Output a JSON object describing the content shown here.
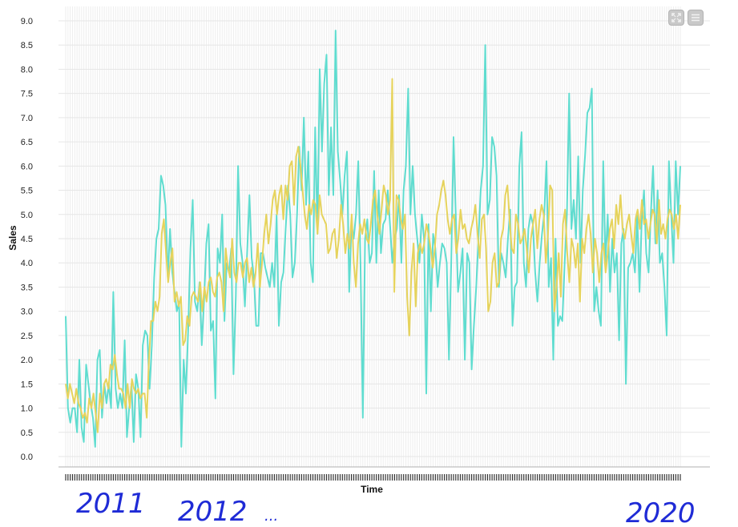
{
  "toolbar": {
    "expand_icon": "expand-icon",
    "menu_icon": "menu-icon"
  },
  "annotations": [
    "2011",
    "2012",
    "...",
    "2020"
  ],
  "chart_data": {
    "type": "line",
    "xlabel": "Time",
    "ylabel": "Sales",
    "ylim": [
      0,
      9
    ],
    "yticks": [
      "0.0",
      "0.5",
      "1.0",
      "1.5",
      "2.0",
      "2.5",
      "3.0",
      "3.5",
      "4.0",
      "4.5",
      "5.0",
      "5.5",
      "6.0",
      "6.5",
      "7.0",
      "7.5",
      "8.0",
      "8.5",
      "9.0"
    ],
    "grid": true,
    "colors": {
      "actual": "#5fdccf",
      "smoothed": "#e6d35c",
      "grid": "#e6e6e6",
      "vgrid": "#eeeeee"
    },
    "series": [
      {
        "name": "",
        "values": [
          2.9,
          1.0,
          0.7,
          1.0,
          1.0,
          0.5,
          2.0,
          0.6,
          0.3,
          1.9,
          1.5,
          1.1,
          0.8,
          0.2,
          2.0,
          2.2,
          0.8,
          1.5,
          1.1,
          1.5,
          1.0,
          3.4,
          1.4,
          1.0,
          1.3,
          1.0,
          2.4,
          0.4,
          1.0,
          1.5,
          0.3,
          1.7,
          1.4,
          0.4,
          2.3,
          2.6,
          2.5,
          1.4,
          2.3,
          3.7,
          4.5,
          4.7,
          5.8,
          5.6,
          5.2,
          3.7,
          4.7,
          3.8,
          3.4,
          3.0,
          3.2,
          0.2,
          2.0,
          1.3,
          2.6,
          4.3,
          5.3,
          3.2,
          3.0,
          3.6,
          2.3,
          3.2,
          4.4,
          4.8,
          2.6,
          2.8,
          1.2,
          4.3,
          4.0,
          5.0,
          2.8,
          4.0,
          3.8,
          4.3,
          1.7,
          3.3,
          6.0,
          4.4,
          4.0,
          3.1,
          4.2,
          5.4,
          4.1,
          3.7,
          2.7,
          2.7,
          4.2,
          4.2,
          3.9,
          3.7,
          3.5,
          4.0,
          3.5,
          5.0,
          2.7,
          3.6,
          3.8,
          4.7,
          5.6,
          5.0,
          3.7,
          4.0,
          5.0,
          6.4,
          5.5,
          7.0,
          5.2,
          6.3,
          4.0,
          3.6,
          6.8,
          4.6,
          8.0,
          6.3,
          7.7,
          8.3,
          5.4,
          6.8,
          5.4,
          8.8,
          6.3,
          5.7,
          5.0,
          5.8,
          6.3,
          3.4,
          4.8,
          4.5,
          5.0,
          6.1,
          4.0,
          0.8,
          4.5,
          4.9,
          4.0,
          4.2,
          5.9,
          4.0,
          5.5,
          4.2,
          4.8,
          4.9,
          5.5,
          4.8,
          4.0,
          4.5,
          4.7,
          5.4,
          4.0,
          5.5,
          6.0,
          7.6,
          5.0,
          6.0,
          5.0,
          4.5,
          4.0,
          5.0,
          4.5,
          1.3,
          4.8,
          3.0,
          4.6,
          4.3,
          3.5,
          4.0,
          4.4,
          4.3,
          4.0,
          2.0,
          4.0,
          6.6,
          5.0,
          3.4,
          3.8,
          4.3,
          2.0,
          4.2,
          4.0,
          1.8,
          2.7,
          3.5,
          4.5,
          5.5,
          6.0,
          8.5,
          5.0,
          5.3,
          6.6,
          6.4,
          5.8,
          3.5,
          4.2,
          4.0,
          3.7,
          4.5,
          5.1,
          2.7,
          3.5,
          3.6,
          6.0,
          6.7,
          4.0,
          3.5,
          4.7,
          5.0,
          4.8,
          3.8,
          3.2,
          4.0,
          4.6,
          5.0,
          6.1,
          3.5,
          4.1,
          2.0,
          4.5,
          2.7,
          2.9,
          2.8,
          4.0,
          5.0,
          7.5,
          4.7,
          5.3,
          4.5,
          6.2,
          4.0,
          5.5,
          6.2,
          7.1,
          7.2,
          7.6,
          3.0,
          3.5,
          3.0,
          2.7,
          6.1,
          4.0,
          5.0,
          3.4,
          4.5,
          3.8,
          4.2,
          2.4,
          4.4,
          4.7,
          1.5,
          3.9,
          4.0,
          4.2,
          3.8,
          5.0,
          3.4,
          4.9,
          5.5,
          4.2,
          3.8,
          5.0,
          6.0,
          4.4,
          5.5,
          4.0,
          4.2,
          3.5,
          2.5,
          6.1,
          5.0,
          4.0,
          6.1,
          5.0,
          6.0
        ],
        "color": "#5fdccf"
      },
      {
        "name": "",
        "values": [
          1.5,
          1.2,
          1.5,
          1.3,
          1.1,
          1.4,
          1.1,
          1.0,
          0.8,
          0.9,
          0.7,
          1.2,
          1.0,
          1.3,
          0.9,
          0.5,
          1.3,
          1.0,
          1.5,
          1.6,
          1.4,
          1.9,
          1.8,
          2.1,
          1.7,
          1.4,
          1.4,
          1.3,
          1.0,
          1.5,
          1.0,
          1.6,
          1.4,
          1.3,
          1.4,
          1.2,
          1.3,
          1.3,
          0.8,
          2.0,
          2.8,
          2.8,
          3.2,
          3.0,
          3.3,
          4.6,
          4.9,
          4.2,
          3.6,
          4.0,
          4.3,
          3.2,
          3.4,
          3.1,
          3.3,
          2.3,
          2.4,
          2.9,
          2.7,
          3.3,
          3.4,
          3.3,
          3.2,
          3.6,
          3.0,
          3.5,
          3.2,
          3.6,
          3.7,
          3.4,
          3.3,
          3.7,
          3.8,
          3.6,
          3.0,
          4.3,
          3.9,
          3.7,
          4.5,
          3.8,
          3.6,
          4.0,
          4.0,
          3.7,
          4.0,
          4.1,
          3.6,
          3.9,
          3.5,
          3.8,
          4.4,
          3.5,
          4.0,
          4.6,
          5.0,
          4.4,
          4.8,
          5.3,
          5.5,
          5.0,
          5.4,
          5.6,
          4.9,
          5.6,
          5.3,
          6.0,
          6.1,
          5.2,
          6.2,
          6.4,
          6.0,
          5.5,
          5.0,
          4.7,
          5.2,
          5.0,
          5.3,
          5.2,
          4.6,
          5.4,
          5.0,
          4.9,
          4.8,
          4.2,
          4.3,
          4.6,
          4.7,
          4.1,
          4.5,
          5.2,
          4.8,
          4.2,
          4.6,
          4.3,
          5.0,
          4.0,
          3.5,
          4.4,
          4.8,
          4.6,
          4.9,
          4.5,
          4.4,
          4.8,
          5.3,
          5.5,
          5.0,
          4.6,
          5.1,
          5.6,
          5.4,
          5.0,
          5.3,
          7.8,
          3.4,
          5.4,
          5.3,
          4.9,
          4.7,
          5.0,
          3.3,
          2.5,
          3.8,
          4.4,
          3.1,
          4.2,
          4.4,
          4.2,
          4.4,
          4.8,
          4.6,
          4.3,
          3.9,
          4.3,
          5.0,
          5.2,
          5.5,
          5.7,
          5.4,
          4.9,
          4.6,
          4.9,
          5.0,
          4.2,
          4.5,
          5.1,
          4.7,
          4.8,
          4.5,
          4.4,
          4.7,
          4.9,
          5.2,
          4.6,
          4.1,
          4.9,
          5.0,
          4.3,
          3.0,
          3.2,
          4.0,
          4.2,
          3.5,
          3.6,
          4.5,
          4.7,
          5.4,
          5.6,
          4.9,
          4.3,
          4.2,
          5.0,
          4.8,
          4.4,
          4.5,
          4.7,
          4.3,
          3.8,
          4.5,
          4.8,
          5.1,
          4.3,
          4.9,
          5.2,
          5.0,
          4.0,
          4.6,
          5.6,
          5.5,
          3.0,
          3.5,
          4.2,
          3.3,
          4.8,
          5.1,
          4.2,
          3.6,
          4.5,
          4.3,
          3.9,
          4.4,
          3.2,
          4.5,
          4.2,
          4.7,
          5.0,
          4.6,
          3.8,
          4.5,
          4.2,
          3.6,
          4.2,
          4.4,
          3.8,
          4.2,
          4.7,
          4.9,
          4.3,
          5.2,
          4.8,
          5.4,
          4.7,
          4.5,
          4.8,
          5.0,
          4.6,
          4.2,
          4.9,
          5.1,
          4.7,
          5.3,
          4.8,
          4.9,
          4.5,
          4.8,
          5.1,
          5.0,
          4.4,
          5.3,
          4.6,
          4.8,
          4.5,
          4.9,
          5.1,
          5.0,
          4.7,
          5.0,
          4.5,
          5.2
        ],
        "color": "#e6d35c"
      }
    ]
  }
}
